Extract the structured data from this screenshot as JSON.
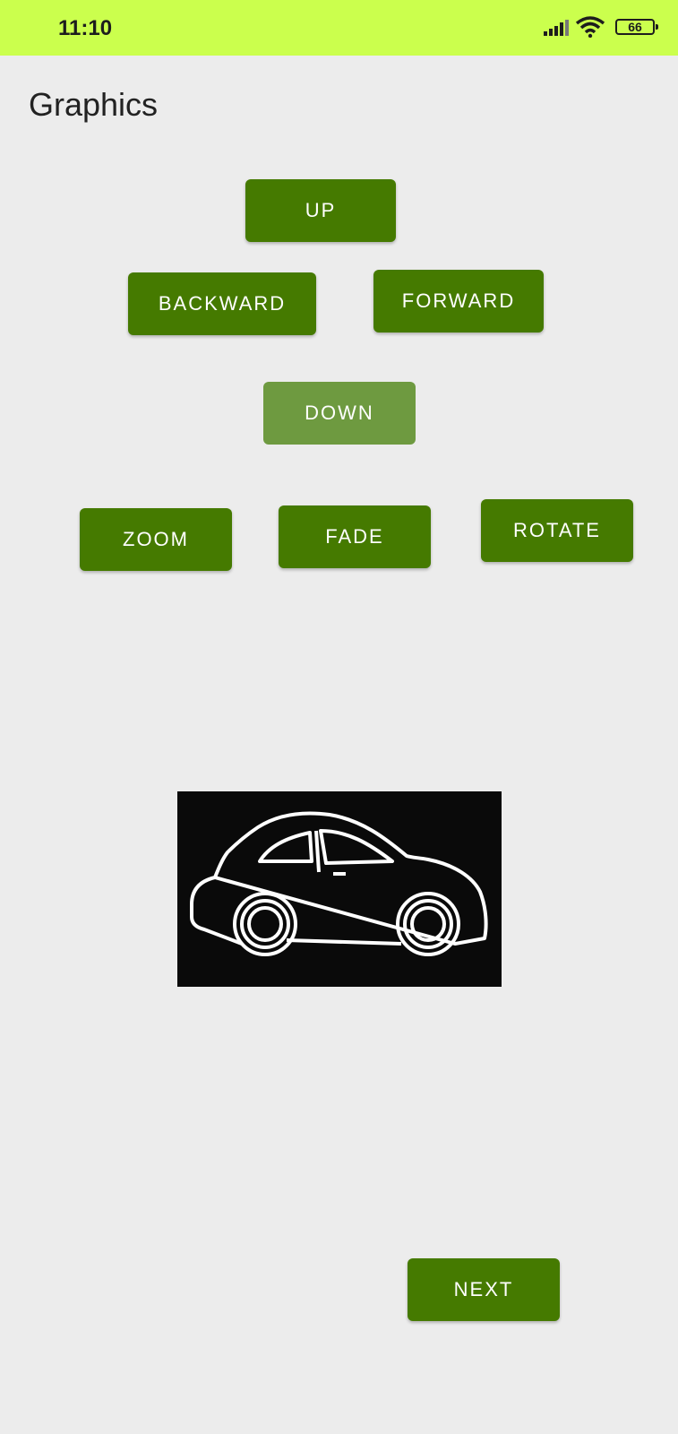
{
  "status_bar": {
    "time": "11:10",
    "battery": "66",
    "icons": [
      "signal-icon",
      "wifi-icon",
      "battery-icon"
    ],
    "background_color": "#cbff4d"
  },
  "page": {
    "title": "Graphics"
  },
  "buttons": {
    "up": "UP",
    "backward": "BACKWARD",
    "forward": "FORWARD",
    "down": "DOWN",
    "zoom": "ZOOM",
    "fade": "FADE",
    "rotate": "ROTATE",
    "next": "NEXT"
  },
  "colors": {
    "button": "#457a00",
    "button_disabled": "#6e9a40",
    "background": "#ececec"
  },
  "image": {
    "icon": "car-icon"
  }
}
